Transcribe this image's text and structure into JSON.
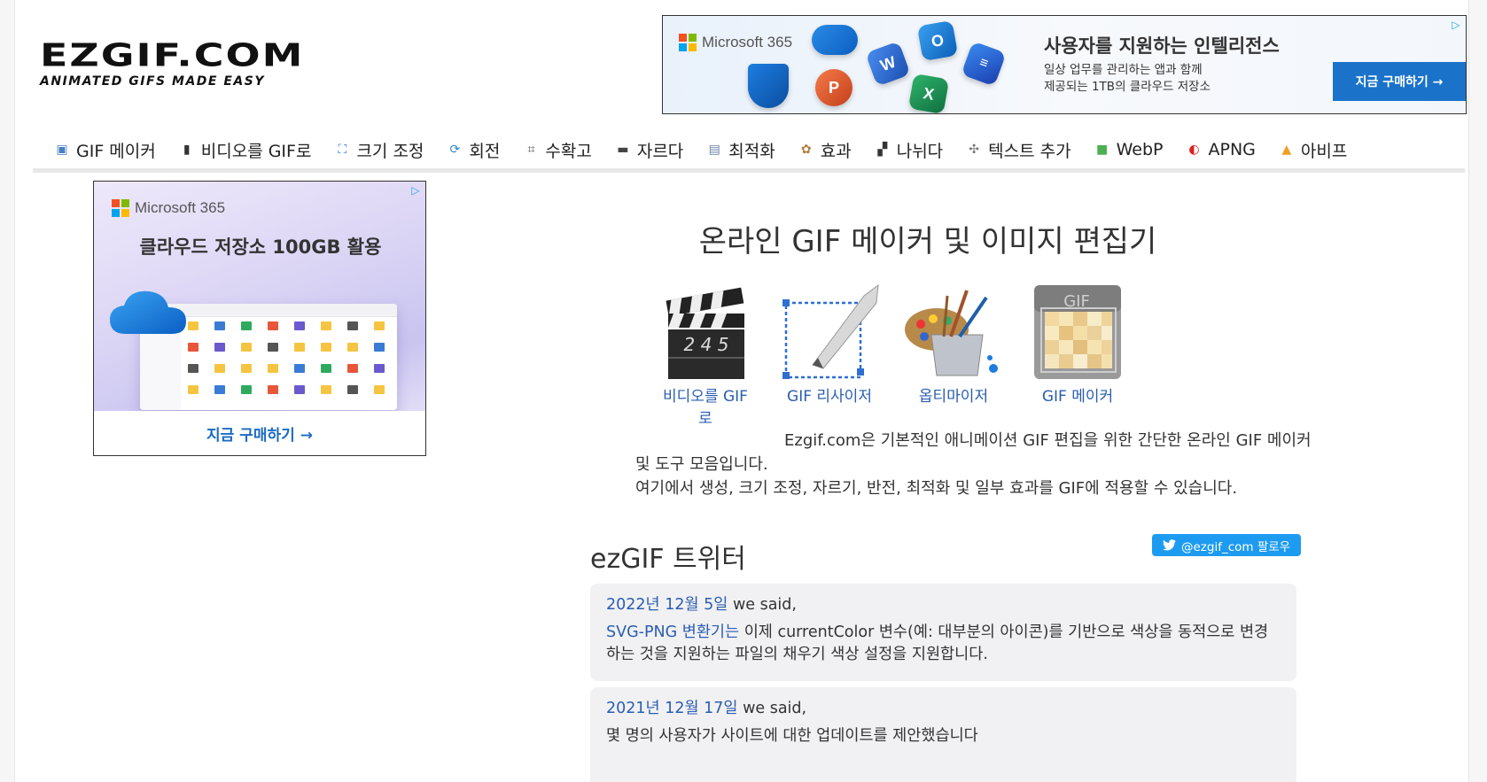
{
  "logo": {
    "main": "EZGIF.COM",
    "tagline": "ANIMATED GIFS MADE EASY"
  },
  "ad_top": {
    "brand": "Microsoft 365",
    "headline": "사용자를 지원하는 인텔리전스",
    "sub_line1": "일상 업무를 관리하는 앱과 함께",
    "sub_line2": "제공되는 1TB의 클라우드 저장소",
    "cta": "지금 구매하기 →"
  },
  "nav": {
    "items": [
      {
        "label": "GIF 메이커",
        "icon": "gif-maker-icon",
        "color": "#4a7fc1"
      },
      {
        "label": "비디오를 GIF로",
        "icon": "film-icon",
        "color": "#333333"
      },
      {
        "label": "크기 조정",
        "icon": "resize-icon",
        "color": "#3b6fd1"
      },
      {
        "label": "회전",
        "icon": "rotate-icon",
        "color": "#2f86c9"
      },
      {
        "label": "수확고",
        "icon": "crop-icon",
        "color": "#555555"
      },
      {
        "label": "자르다",
        "icon": "cut-icon",
        "color": "#444444"
      },
      {
        "label": "최적화",
        "icon": "optimize-icon",
        "color": "#6a7fa8"
      },
      {
        "label": "효과",
        "icon": "palette-icon",
        "color": "#b07a3a"
      },
      {
        "label": "나뉘다",
        "icon": "split-icon",
        "color": "#333333"
      },
      {
        "label": "텍스트 추가",
        "icon": "text-add-icon",
        "color": "#777777"
      },
      {
        "label": "WebP",
        "icon": "webp-icon",
        "color": "#4caf50"
      },
      {
        "label": "APNG",
        "icon": "apng-icon",
        "color": "#e02020"
      },
      {
        "label": "아비프",
        "icon": "avif-icon",
        "color": "#f0a020"
      }
    ]
  },
  "ad_left": {
    "brand": "Microsoft 365",
    "headline": "클라우드 저장소 100GB 활용",
    "cta": "지금 구매하기 →"
  },
  "main": {
    "title": "온라인 GIF 메이커 및 이미지 편집기",
    "tools": [
      {
        "line1": "비디오를 GIF",
        "line2": "로",
        "icon": "clapperboard-icon",
        "clapper_number": "2 4 5"
      },
      {
        "line1": "GIF 리사이저",
        "line2": "",
        "icon": "resize-pen-icon"
      },
      {
        "line1": "옵티마이저",
        "line2": "",
        "icon": "paint-bucket-icon"
      },
      {
        "line1": "GIF 메이커",
        "line2": "",
        "icon": "gif-file-icon",
        "file_label": "GIF"
      }
    ],
    "intro_line1": "Ezgif.com은 기본적인 애니메이션 GIF 편집을 위한 간단한 온라인 GIF 메이커",
    "intro_line2": "및 도구 모음입니다.",
    "intro_line3": "여기에서 생성, 크기 조정, 자르기, 반전, 최적화 및 일부 효과를 GIF에 적용할 수 있습니다."
  },
  "twitter": {
    "title": "ezGIF 트위터",
    "follow": "@ezgif_com 팔로우",
    "tweets": [
      {
        "date": "2022년 12월 5일",
        "said": " we said,",
        "link": "SVG-PNG 변환기는",
        "text": " 이제 currentColor 변수(예: 대부분의 아이콘)를 기반으로 색상을 동적으로 변경하는 것을 지원하는 파일의 채우기 색상 설정을 지원합니다."
      },
      {
        "date": "2021년 12월 17일",
        "said": " we said,",
        "text": "몇 명의 사용자가 사이트에 대한 업데이트를 제안했습니다"
      }
    ]
  }
}
